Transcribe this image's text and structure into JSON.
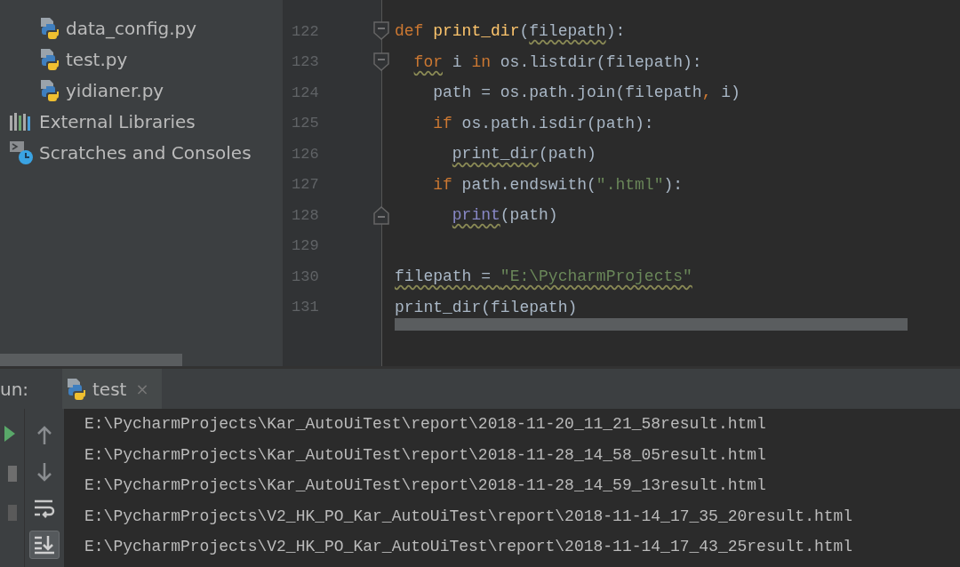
{
  "project_tree": [
    {
      "kind": "file",
      "label": "data_config.py"
    },
    {
      "kind": "file",
      "label": "test.py"
    },
    {
      "kind": "file",
      "label": "yidianer.py"
    },
    {
      "kind": "libraries",
      "label": "External Libraries"
    },
    {
      "kind": "scratches",
      "label": "Scratches and Consoles"
    }
  ],
  "editor": {
    "lines": [
      {
        "number": "122",
        "fold_start": true,
        "fold_end": false,
        "tokens": [
          {
            "text": "def ",
            "kind": "keyword",
            "underlined": false
          },
          {
            "text": "print_dir",
            "kind": "funcdef",
            "underlined": false
          },
          {
            "text": "(",
            "kind": "plain",
            "underlined": false
          },
          {
            "text": "filepath",
            "kind": "plain",
            "underlined": true
          },
          {
            "text": "):",
            "kind": "plain",
            "underlined": false
          }
        ],
        "children": [
          {
            "number": "123",
            "fold_start": true,
            "fold_end": false,
            "tokens": [
              {
                "text": "for",
                "kind": "keyword",
                "underlined": true
              },
              {
                "text": " i ",
                "kind": "plain",
                "underlined": false
              },
              {
                "text": "in",
                "kind": "keyword",
                "underlined": false
              },
              {
                "text": " os.listdir(filepath):",
                "kind": "plain",
                "underlined": false
              }
            ],
            "children": [
              {
                "number": "124",
                "fold_start": false,
                "fold_end": false,
                "tokens": [
                  {
                    "text": "path = os.path.join(filepath",
                    "kind": "plain",
                    "underlined": false
                  },
                  {
                    "text": ",",
                    "kind": "punct",
                    "underlined": false
                  },
                  {
                    "text": " i)",
                    "kind": "plain",
                    "underlined": false
                  }
                ]
              },
              {
                "number": "125",
                "fold_start": false,
                "fold_end": false,
                "tokens": [
                  {
                    "text": "if",
                    "kind": "keyword",
                    "underlined": false
                  },
                  {
                    "text": " os.path.isdir(path):",
                    "kind": "plain",
                    "underlined": false
                  }
                ],
                "children": [
                  {
                    "number": "126",
                    "fold_start": false,
                    "fold_end": false,
                    "tokens": [
                      {
                        "text": "print_dir",
                        "kind": "plain",
                        "underlined": true
                      },
                      {
                        "text": "(path)",
                        "kind": "plain",
                        "underlined": false
                      }
                    ]
                  }
                ]
              },
              {
                "number": "127",
                "fold_start": false,
                "fold_end": false,
                "tokens": [
                  {
                    "text": "if",
                    "kind": "keyword",
                    "underlined": false
                  },
                  {
                    "text": " path.endswith(",
                    "kind": "plain",
                    "underlined": false
                  },
                  {
                    "text": "\".html\"",
                    "kind": "string",
                    "underlined": false
                  },
                  {
                    "text": "):",
                    "kind": "plain",
                    "underlined": false
                  }
                ],
                "children": [
                  {
                    "number": "128",
                    "fold_start": false,
                    "fold_end": true,
                    "tokens": [
                      {
                        "text": "print",
                        "kind": "builtin",
                        "underlined": true
                      },
                      {
                        "text": "(path)",
                        "kind": "plain",
                        "underlined": false
                      }
                    ]
                  }
                ]
              }
            ]
          }
        ]
      },
      {
        "number": "129",
        "fold_start": false,
        "fold_end": false
      },
      {
        "number": "130",
        "fold_start": false,
        "fold_end": false,
        "tokens": [
          {
            "text": "filepath = ",
            "kind": "plain",
            "underlined": true
          },
          {
            "text": "\"E:\\PycharmProjects\"",
            "kind": "string",
            "underlined": true
          }
        ]
      },
      {
        "number": "131",
        "fold_start": false,
        "fold_end": false,
        "tokens": [
          {
            "text": "print_dir(filepath)",
            "kind": "plain",
            "underlined": false
          }
        ]
      }
    ]
  },
  "run_panel": {
    "label": "un:",
    "tabs": [
      {
        "label": "test",
        "close": "×",
        "selected": true
      }
    ],
    "tool_buttons": [
      {
        "kind": "up",
        "on": false
      },
      {
        "kind": "down",
        "on": false
      },
      {
        "kind": "wrap",
        "on": false
      },
      {
        "kind": "scroll-end",
        "on": true
      }
    ],
    "output": [
      "E:\\PycharmProjects\\Kar_AutoUiTest\\report\\2018-11-20_11_21_58result.html",
      "E:\\PycharmProjects\\Kar_AutoUiTest\\report\\2018-11-28_14_58_05result.html",
      "E:\\PycharmProjects\\Kar_AutoUiTest\\report\\2018-11-28_14_59_13result.html",
      "E:\\PycharmProjects\\V2_HK_PO_Kar_AutoUiTest\\report\\2018-11-14_17_35_20result.html",
      "E:\\PycharmProjects\\V2_HK_PO_Kar_AutoUiTest\\report\\2018-11-14_17_43_25result.html"
    ]
  }
}
